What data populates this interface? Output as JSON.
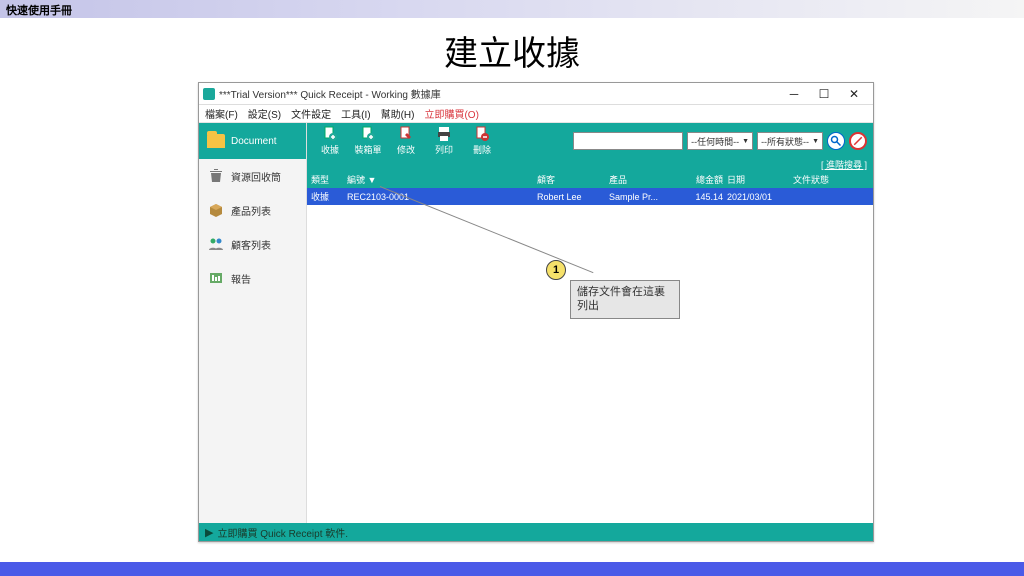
{
  "doc_header": "快速使用手冊",
  "page_title": "建立收據",
  "window": {
    "title": "***Trial Version*** Quick Receipt - Working 數據庫"
  },
  "menubar": {
    "file": "檔案(F)",
    "settings": "設定(S)",
    "docset": "文件設定",
    "tools": "工具(I)",
    "help": "幫助(H)",
    "buy": "立即購買(O)"
  },
  "sidebar": {
    "document": "Document",
    "trash": "資源回收筒",
    "products": "產品列表",
    "customers": "顧客列表",
    "reports": "報告"
  },
  "toolbar": {
    "receipt": "收據",
    "packing": "裝箱單",
    "edit": "修改",
    "print": "列印",
    "delete": "刪除",
    "time_filter": "--任何時間--",
    "status_filter": "--所有狀態--",
    "advanced": "[ 進階搜尋 ]"
  },
  "columns": {
    "type": "類型",
    "number": "編號 ▼",
    "customer": "顧客",
    "product": "產品",
    "amount": "總金額",
    "date": "日期",
    "status": "文件狀態"
  },
  "rows": [
    {
      "type": "收據",
      "number": "REC2103-0001",
      "customer": "Robert Lee",
      "product": "Sample Pr...",
      "amount": "145.14",
      "date": "2021/03/01",
      "status": ""
    }
  ],
  "statusbar": "立即購買 Quick Receipt 軟件.",
  "callout": {
    "num": "1",
    "text": "儲存文件會在這裏列出"
  }
}
